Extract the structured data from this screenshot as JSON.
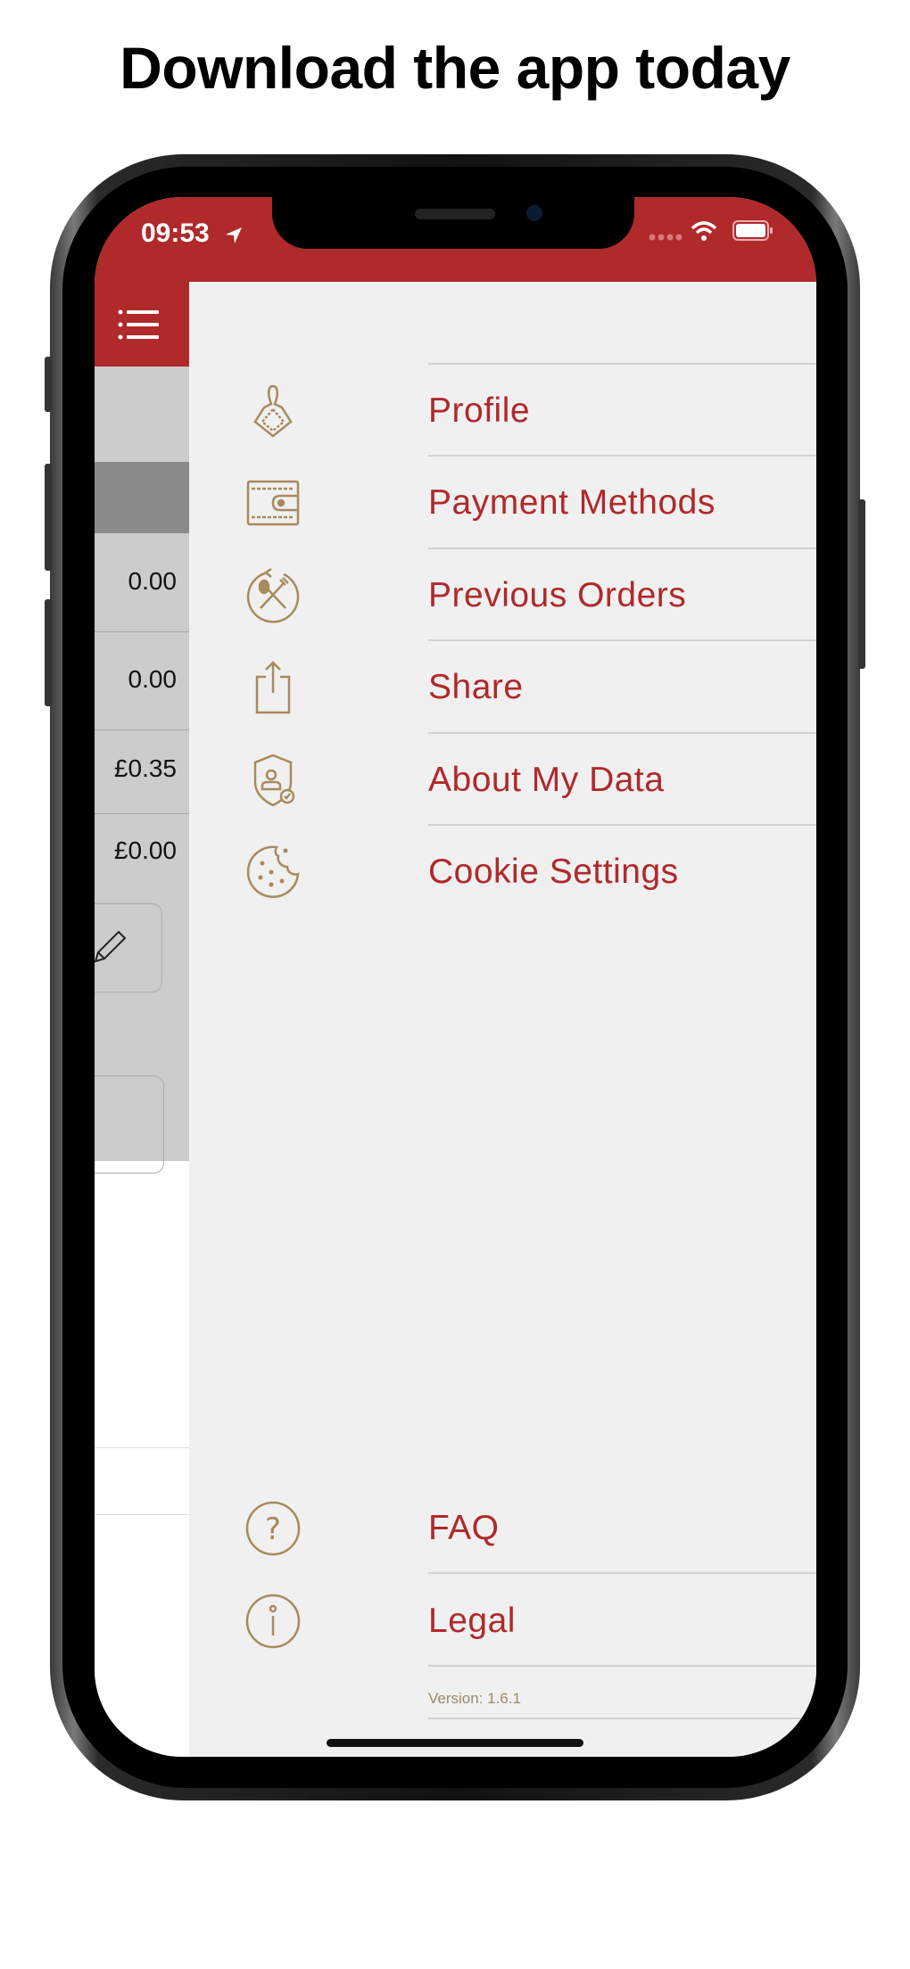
{
  "headline": "Download the app today",
  "status": {
    "time": "09:53",
    "icons": [
      "location-arrow-icon",
      "signal-icon",
      "wifi-icon",
      "battery-icon"
    ]
  },
  "colors": {
    "brand_red": "#b0292b",
    "icon_gold": "#a88a5c",
    "menu_bg": "#f0f0f0"
  },
  "background": {
    "amounts": [
      "0.00",
      "0.00",
      "£0.35",
      "£0.00"
    ]
  },
  "menu": {
    "items": [
      {
        "label": "Profile",
        "icon": "profile-icon"
      },
      {
        "label": "Payment Methods",
        "icon": "wallet-icon"
      },
      {
        "label": "Previous Orders",
        "icon": "previous-orders-icon"
      },
      {
        "label": "Share",
        "icon": "share-icon"
      },
      {
        "label": "About My Data",
        "icon": "data-shield-icon"
      },
      {
        "label": "Cookie Settings",
        "icon": "cookie-icon"
      }
    ],
    "bottom_items": [
      {
        "label": "FAQ",
        "icon": "question-icon"
      },
      {
        "label": "Legal",
        "icon": "info-icon"
      }
    ],
    "version": "Version: 1.6.1"
  }
}
